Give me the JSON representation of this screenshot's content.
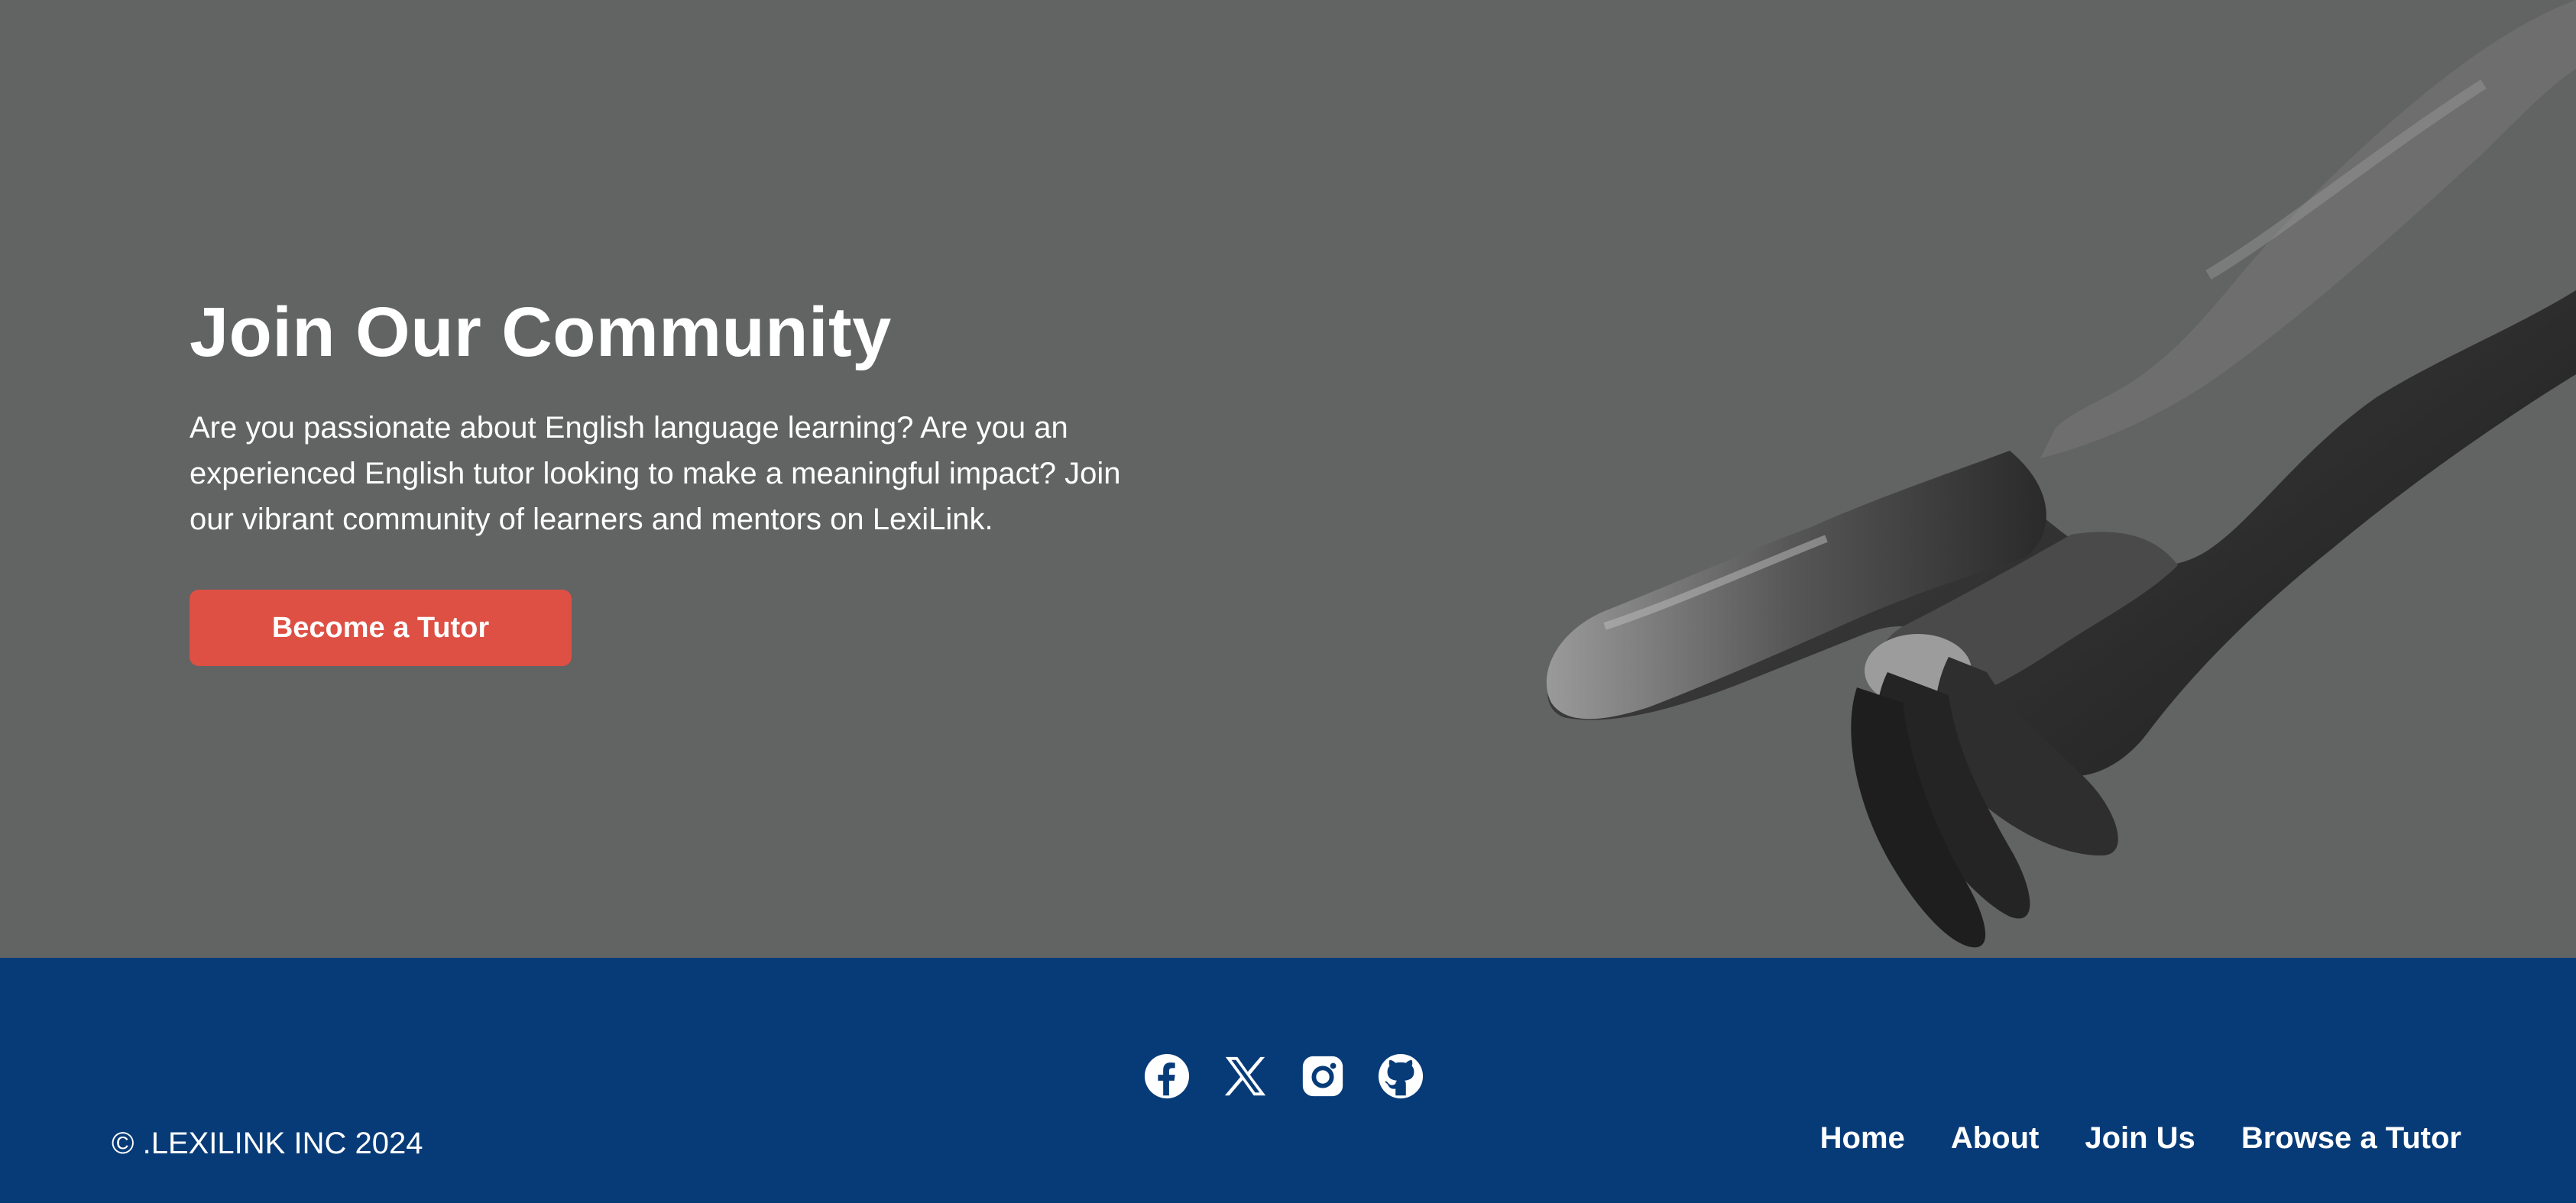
{
  "hero": {
    "title": "Join Our Community",
    "description": "Are you passionate about English language learning? Are you an experienced English tutor looking to make a meaningful impact? Join our vibrant community of learners and mentors on LexiLink.",
    "cta_label": "Become a Tutor",
    "background_color": "#626363",
    "cta_color": "#de4f44",
    "image_icon": "pointing-hand-image"
  },
  "footer": {
    "background_color": "#073b78",
    "copyright": "© .LEXILINK INC 2024",
    "socials": [
      {
        "name": "facebook-icon"
      },
      {
        "name": "x-icon"
      },
      {
        "name": "instagram-icon"
      },
      {
        "name": "github-icon"
      }
    ],
    "nav": [
      {
        "label": "Home"
      },
      {
        "label": "About"
      },
      {
        "label": "Join Us"
      },
      {
        "label": "Browse a Tutor"
      }
    ]
  }
}
